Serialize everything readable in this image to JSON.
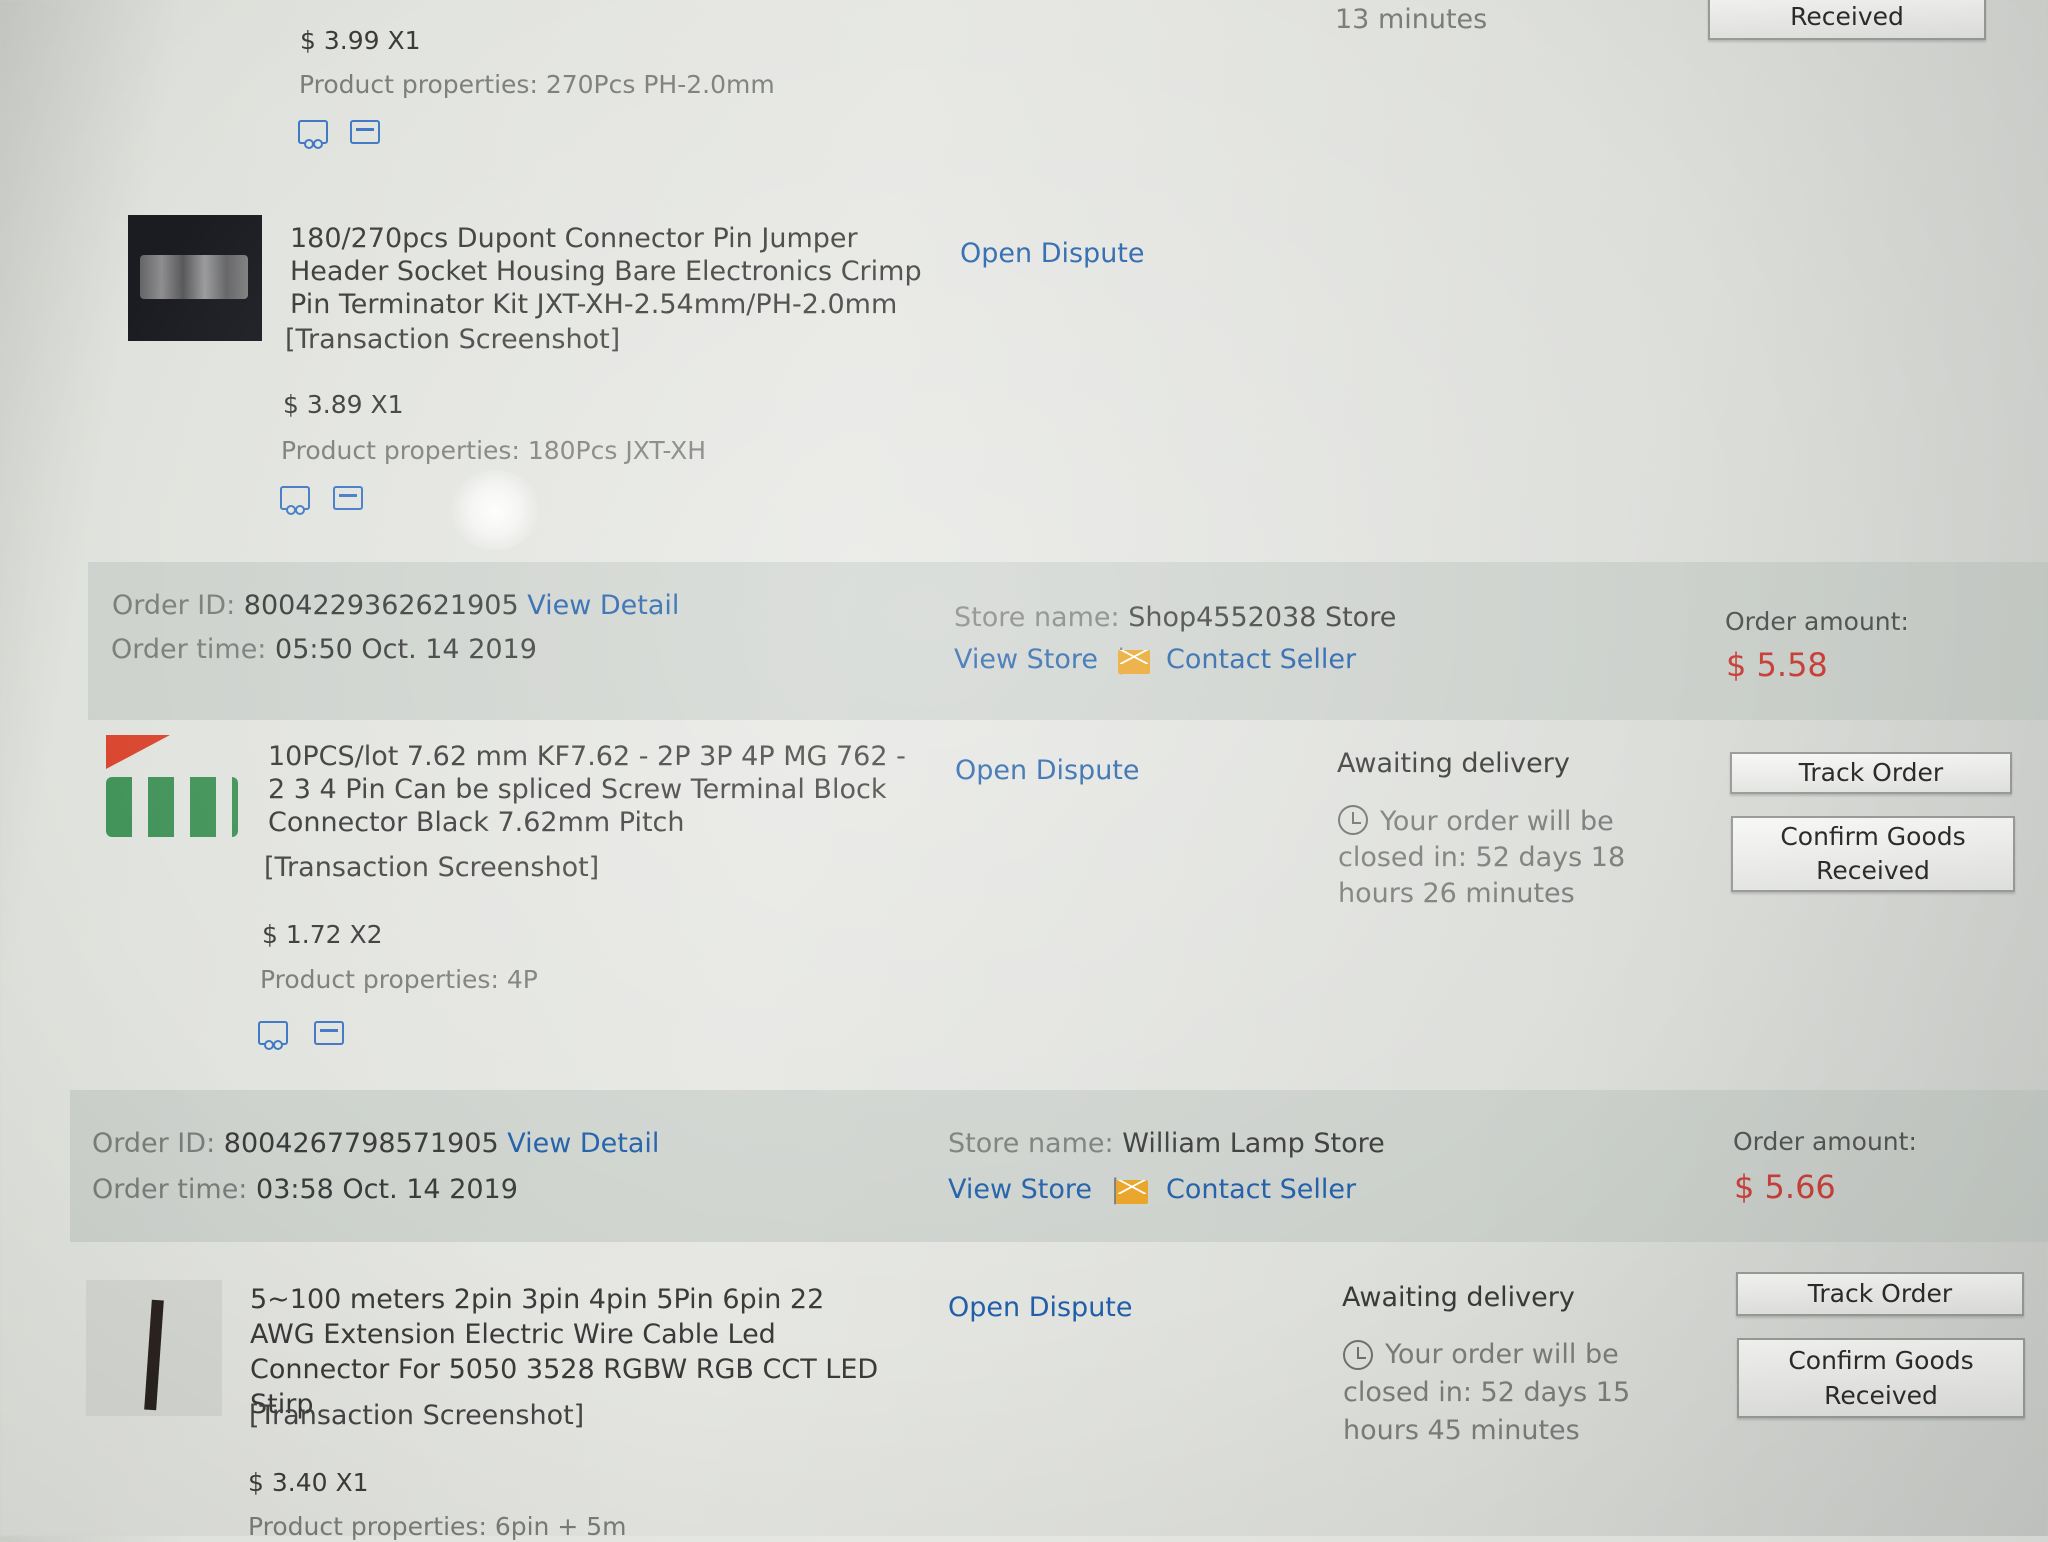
{
  "top_item": {
    "price_qty": "$ 3.99 X1",
    "properties": "Product properties: 270Pcs PH-2.0mm",
    "countdown_tail": "13 minutes",
    "received_button": "Received"
  },
  "item_dupont": {
    "title": "180/270pcs Dupont Connector Pin Jumper Header Socket Housing Bare Electronics Crimp Pin Terminator Kit JXT-XH-2.54mm/PH-2.0mm",
    "screenshot_link": "[Transaction Screenshot]",
    "open_dispute": "Open Dispute",
    "price_qty": "$ 3.89 X1",
    "properties": "Product properties: 180Pcs JXT-XH"
  },
  "order1": {
    "order_id_label": "Order ID:",
    "order_id": "8004229362621905",
    "view_detail": "View Detail",
    "order_time_label": "Order time:",
    "order_time": "05:50 Oct. 14 2019",
    "store_label": "Store name:",
    "store_name": "Shop4552038 Store",
    "view_store": "View Store",
    "separator": "|",
    "contact_seller": "Contact Seller",
    "amount_label": "Order amount:",
    "amount": "$ 5.58",
    "item": {
      "title": "10PCS/lot 7.62 mm KF7.62 - 2P 3P 4P MG 762 - 2 3 4 Pin Can be spliced Screw Terminal Block Connector Black 7.62mm Pitch",
      "screenshot_link": "[Transaction Screenshot]",
      "open_dispute": "Open Dispute",
      "status": "Awaiting delivery",
      "countdown": "Your order will be closed in: 52 days 18 hours 26 minutes",
      "track_order": "Track Order",
      "confirm_goods": "Confirm Goods Received",
      "price_qty": "$ 1.72 X2",
      "properties": "Product properties: 4P"
    }
  },
  "order2": {
    "order_id_label": "Order ID:",
    "order_id": "8004267798571905",
    "view_detail": "View Detail",
    "order_time_label": "Order time:",
    "order_time": "03:58 Oct. 14 2019",
    "store_label": "Store name:",
    "store_name": "William Lamp Store",
    "view_store": "View Store",
    "separator": "|",
    "contact_seller": "Contact Seller",
    "amount_label": "Order amount:",
    "amount": "$ 5.66",
    "item": {
      "title": "5~100 meters 2pin 3pin 4pin 5Pin 6pin 22 AWG Extension Electric Wire Cable Led Connector For 5050 3528 RGBW RGB CCT LED Stirp",
      "screenshot_link": "[Transaction Screenshot]",
      "open_dispute": "Open Dispute",
      "status": "Awaiting delivery",
      "countdown": "Your order will be closed in: 52 days 15 hours 45 minutes",
      "track_order": "Track Order",
      "confirm_goods": "Confirm Goods Received",
      "price_qty": "$ 3.40 X1",
      "properties": "Product properties: 6pin + 5m"
    }
  },
  "icons": [
    "truck-icon",
    "card-icon",
    "clock-icon",
    "mail-icon"
  ],
  "colors": {
    "link": "#1f5ea8",
    "price_red": "#c8403a",
    "mail_icon": "#e9a324",
    "icon_blue": "#3f78c4"
  }
}
